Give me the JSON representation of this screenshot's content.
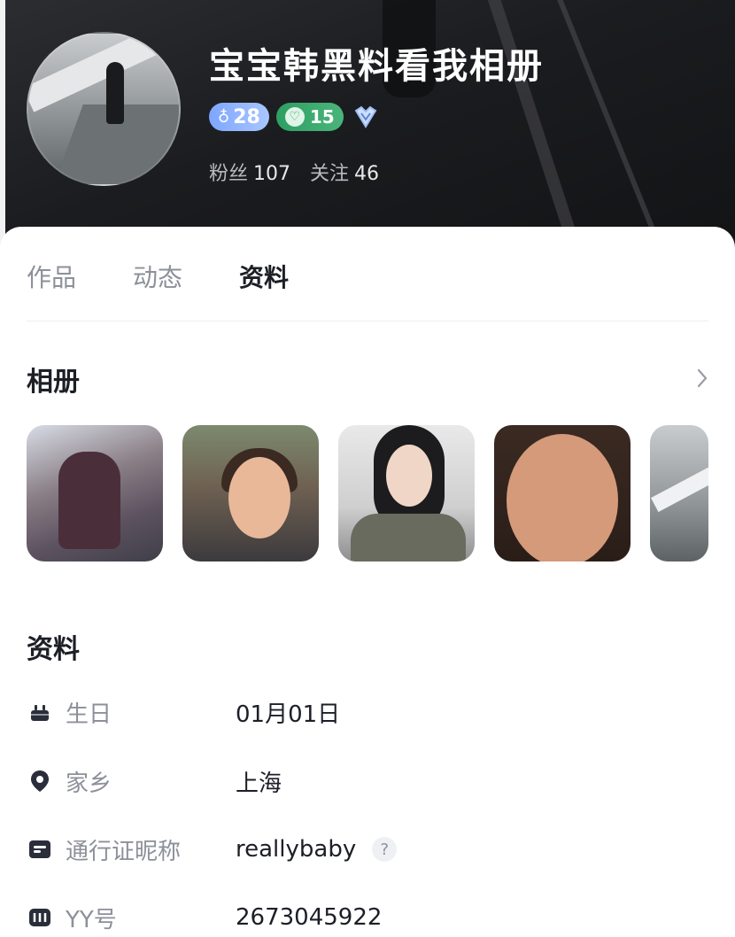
{
  "profile": {
    "name": "宝宝韩黑料看我相册",
    "level": "28",
    "fan_level": "15",
    "followers_label": "粉丝",
    "followers_count": "107",
    "following_label": "关注",
    "following_count": "46"
  },
  "tabs": [
    {
      "label": "作品",
      "active": false
    },
    {
      "label": "动态",
      "active": false
    },
    {
      "label": "资料",
      "active": true
    }
  ],
  "album": {
    "title": "相册",
    "photos": [
      "photo-1",
      "photo-2",
      "photo-3",
      "photo-4",
      "photo-5"
    ]
  },
  "info": {
    "title": "资料",
    "rows": [
      {
        "label": "生日",
        "value": "01月01日",
        "icon": "cake-icon"
      },
      {
        "label": "家乡",
        "value": "上海",
        "icon": "location-pin-icon"
      },
      {
        "label": "通行证昵称",
        "value": "reallybaby",
        "icon": "id-card-icon",
        "help": "?"
      },
      {
        "label": "YY号",
        "value": "2673045922",
        "icon": "yy-logo-icon"
      }
    ]
  },
  "colors": {
    "level_badge": "#7ea6ff",
    "fan_badge": "#2e9e62",
    "text_primary": "#1d1f27",
    "text_secondary": "#8d909a"
  }
}
